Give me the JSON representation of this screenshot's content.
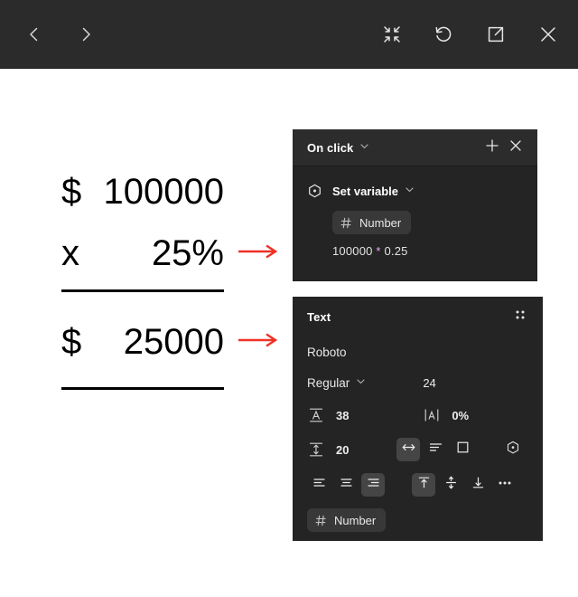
{
  "toolbar": {
    "prev_label": "chevron-left",
    "next_label": "chevron-right",
    "collapse_label": "collapse",
    "restart_label": "restart",
    "open_external_label": "open-external",
    "close_label": "close"
  },
  "calculation": {
    "principal": {
      "symbol": "$",
      "value": "100000"
    },
    "rate": {
      "symbol": "x",
      "value": "25%"
    },
    "result": {
      "symbol": "$",
      "value": "25000"
    },
    "arrow_color": "#ee3124",
    "rule_color": "#000000"
  },
  "onclick_panel": {
    "title": "On click",
    "add_label": "+",
    "close_label": "×",
    "action": {
      "label": "Set variable",
      "variable_chip": "Number",
      "expression_left": "100000",
      "expression_operator": "*",
      "expression_right": "0.25",
      "operator_color": "#e6a8f5"
    }
  },
  "text_panel": {
    "title": "Text",
    "font_family": "Roboto",
    "font_weight": "Regular",
    "font_size": "24",
    "line_height": "38",
    "letter_spacing": "0%",
    "paragraph_spacing": "20",
    "resize_modes": [
      "auto-width",
      "auto-height",
      "fixed-size"
    ],
    "resize_selected": "auto-width",
    "horizontal_align": [
      "align-left",
      "align-center",
      "align-right"
    ],
    "horizontal_selected": "align-right",
    "vertical_align": [
      "align-top",
      "align-middle",
      "align-bottom"
    ],
    "vertical_selected": "align-top",
    "more_label": "•••",
    "variable_chip": "Number"
  }
}
